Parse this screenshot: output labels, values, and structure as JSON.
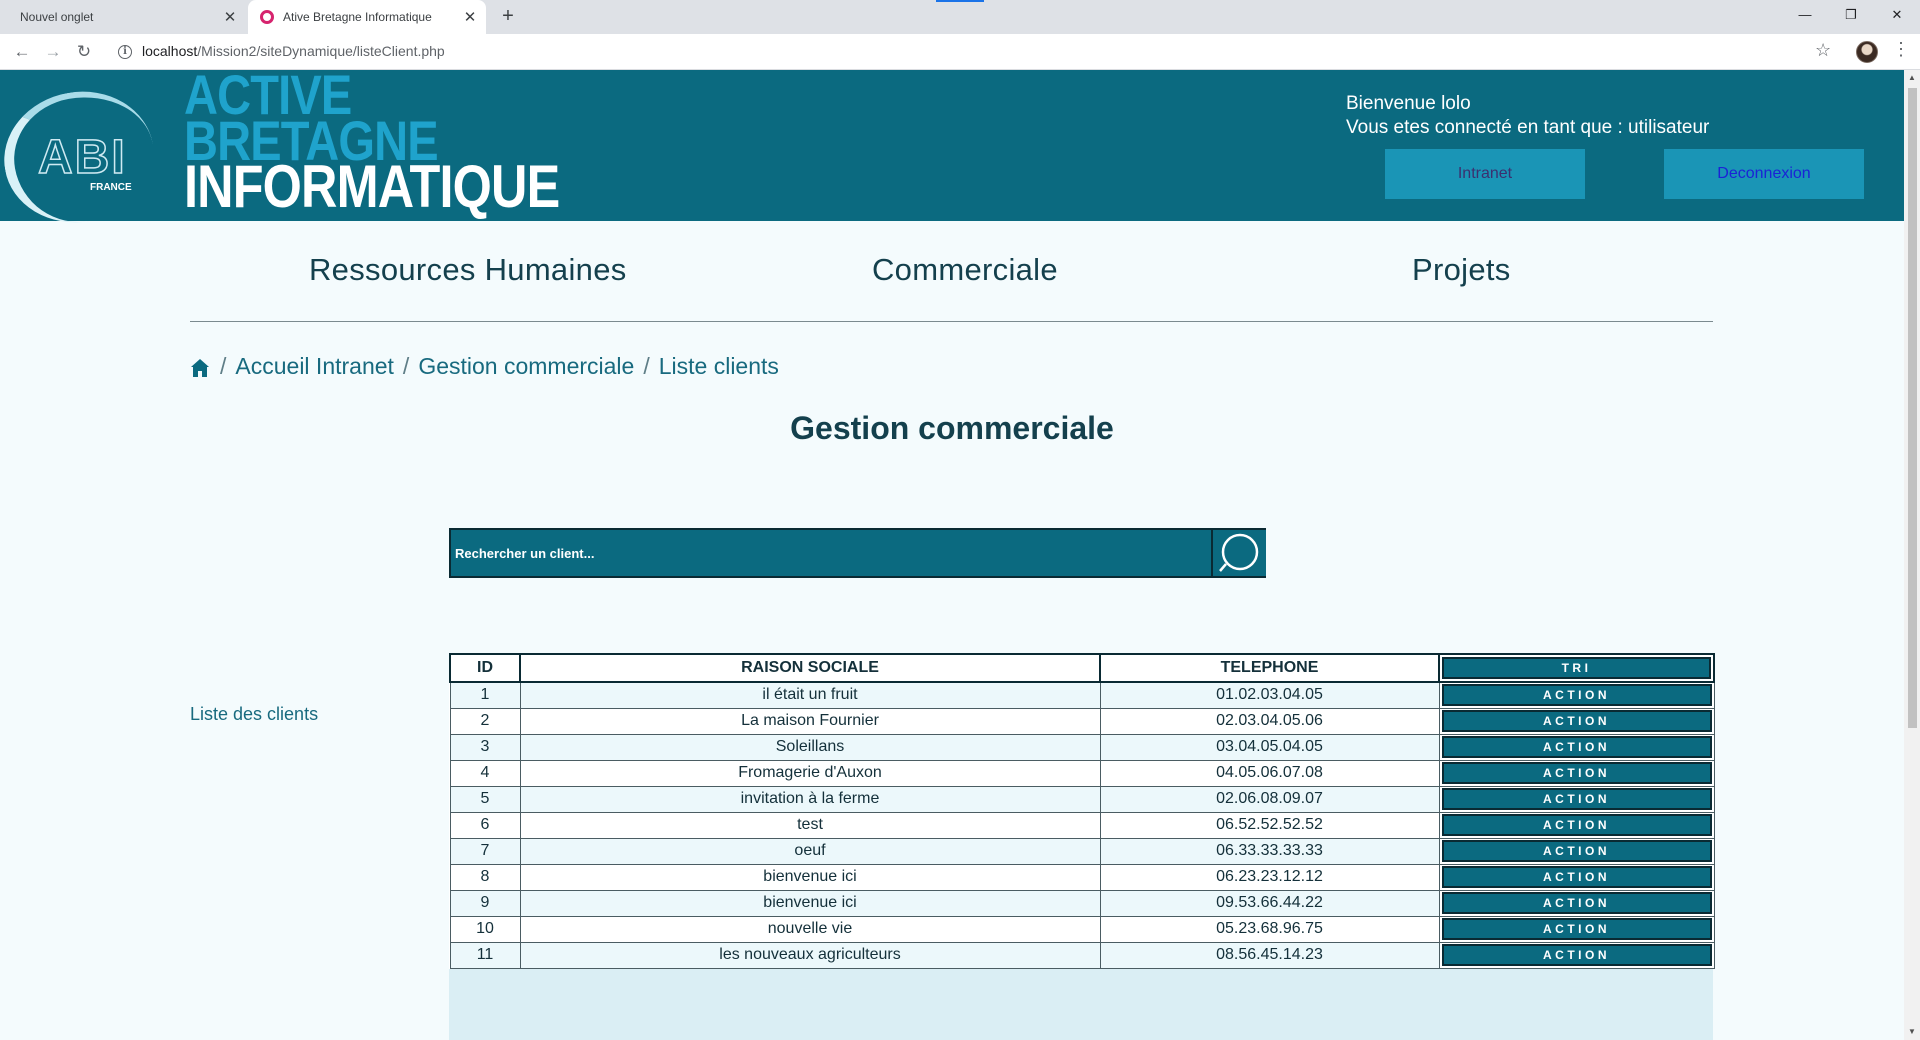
{
  "browser": {
    "tabs": [
      {
        "title": "Nouvel onglet",
        "active": false
      },
      {
        "title": "Ative Bretagne Informatique",
        "active": true
      }
    ],
    "new_tab_symbol": "+",
    "url_host": "localhost",
    "url_path": "/Mission2/siteDynamique/listeClient.php",
    "window_controls": [
      "—",
      "❐",
      "✕"
    ]
  },
  "header": {
    "logo_text": "ABI",
    "logo_sub": "FRANCE",
    "brand_lines": [
      "ACTIVE",
      "BRETAGNE",
      "INFORMATIQUE"
    ],
    "welcome_line1": "Bienvenue lolo",
    "welcome_line2": "Vous etes connecté en tant que : utilisateur",
    "intranet_button": "Intranet",
    "logout_button": "Deconnexion"
  },
  "nav": {
    "items": [
      "Ressources Humaines",
      "Commerciale",
      "Projets"
    ]
  },
  "breadcrumb": {
    "items": [
      "Accueil Intranet",
      "Gestion commerciale",
      "Liste clients"
    ],
    "separator": "/"
  },
  "page": {
    "title": "Gestion commerciale",
    "side_label": "Liste des clients"
  },
  "search": {
    "placeholder": "Rechercher un client..."
  },
  "table": {
    "headers": [
      "ID",
      "RAISON SOCIALE",
      "TELEPHONE",
      "TRI"
    ],
    "action_label": "ACTION",
    "rows": [
      {
        "id": "1",
        "raison": "il était un fruit",
        "tel": "01.02.03.04.05"
      },
      {
        "id": "2",
        "raison": "La maison Fournier",
        "tel": "02.03.04.05.06"
      },
      {
        "id": "3",
        "raison": "Soleillans",
        "tel": "03.04.05.04.05"
      },
      {
        "id": "4",
        "raison": "Fromagerie d'Auxon",
        "tel": "04.05.06.07.08"
      },
      {
        "id": "5",
        "raison": "invitation à la ferme",
        "tel": "02.06.08.09.07"
      },
      {
        "id": "6",
        "raison": "test",
        "tel": "06.52.52.52.52"
      },
      {
        "id": "7",
        "raison": "oeuf",
        "tel": "06.33.33.33.33"
      },
      {
        "id": "8",
        "raison": "bienvenue ici",
        "tel": "06.23.23.12.12"
      },
      {
        "id": "9",
        "raison": "bienvenue ici",
        "tel": "09.53.66.44.22"
      },
      {
        "id": "10",
        "raison": "nouvelle vie",
        "tel": "05.23.68.96.75"
      },
      {
        "id": "11",
        "raison": "les nouveaux agriculteurs",
        "tel": "08.56.45.14.23"
      }
    ]
  },
  "colors": {
    "header_bg": "#0b6a80",
    "brand_accent": "#1fa3cc",
    "page_bg": "#f4fbfd",
    "text_dark": "#14404d"
  }
}
